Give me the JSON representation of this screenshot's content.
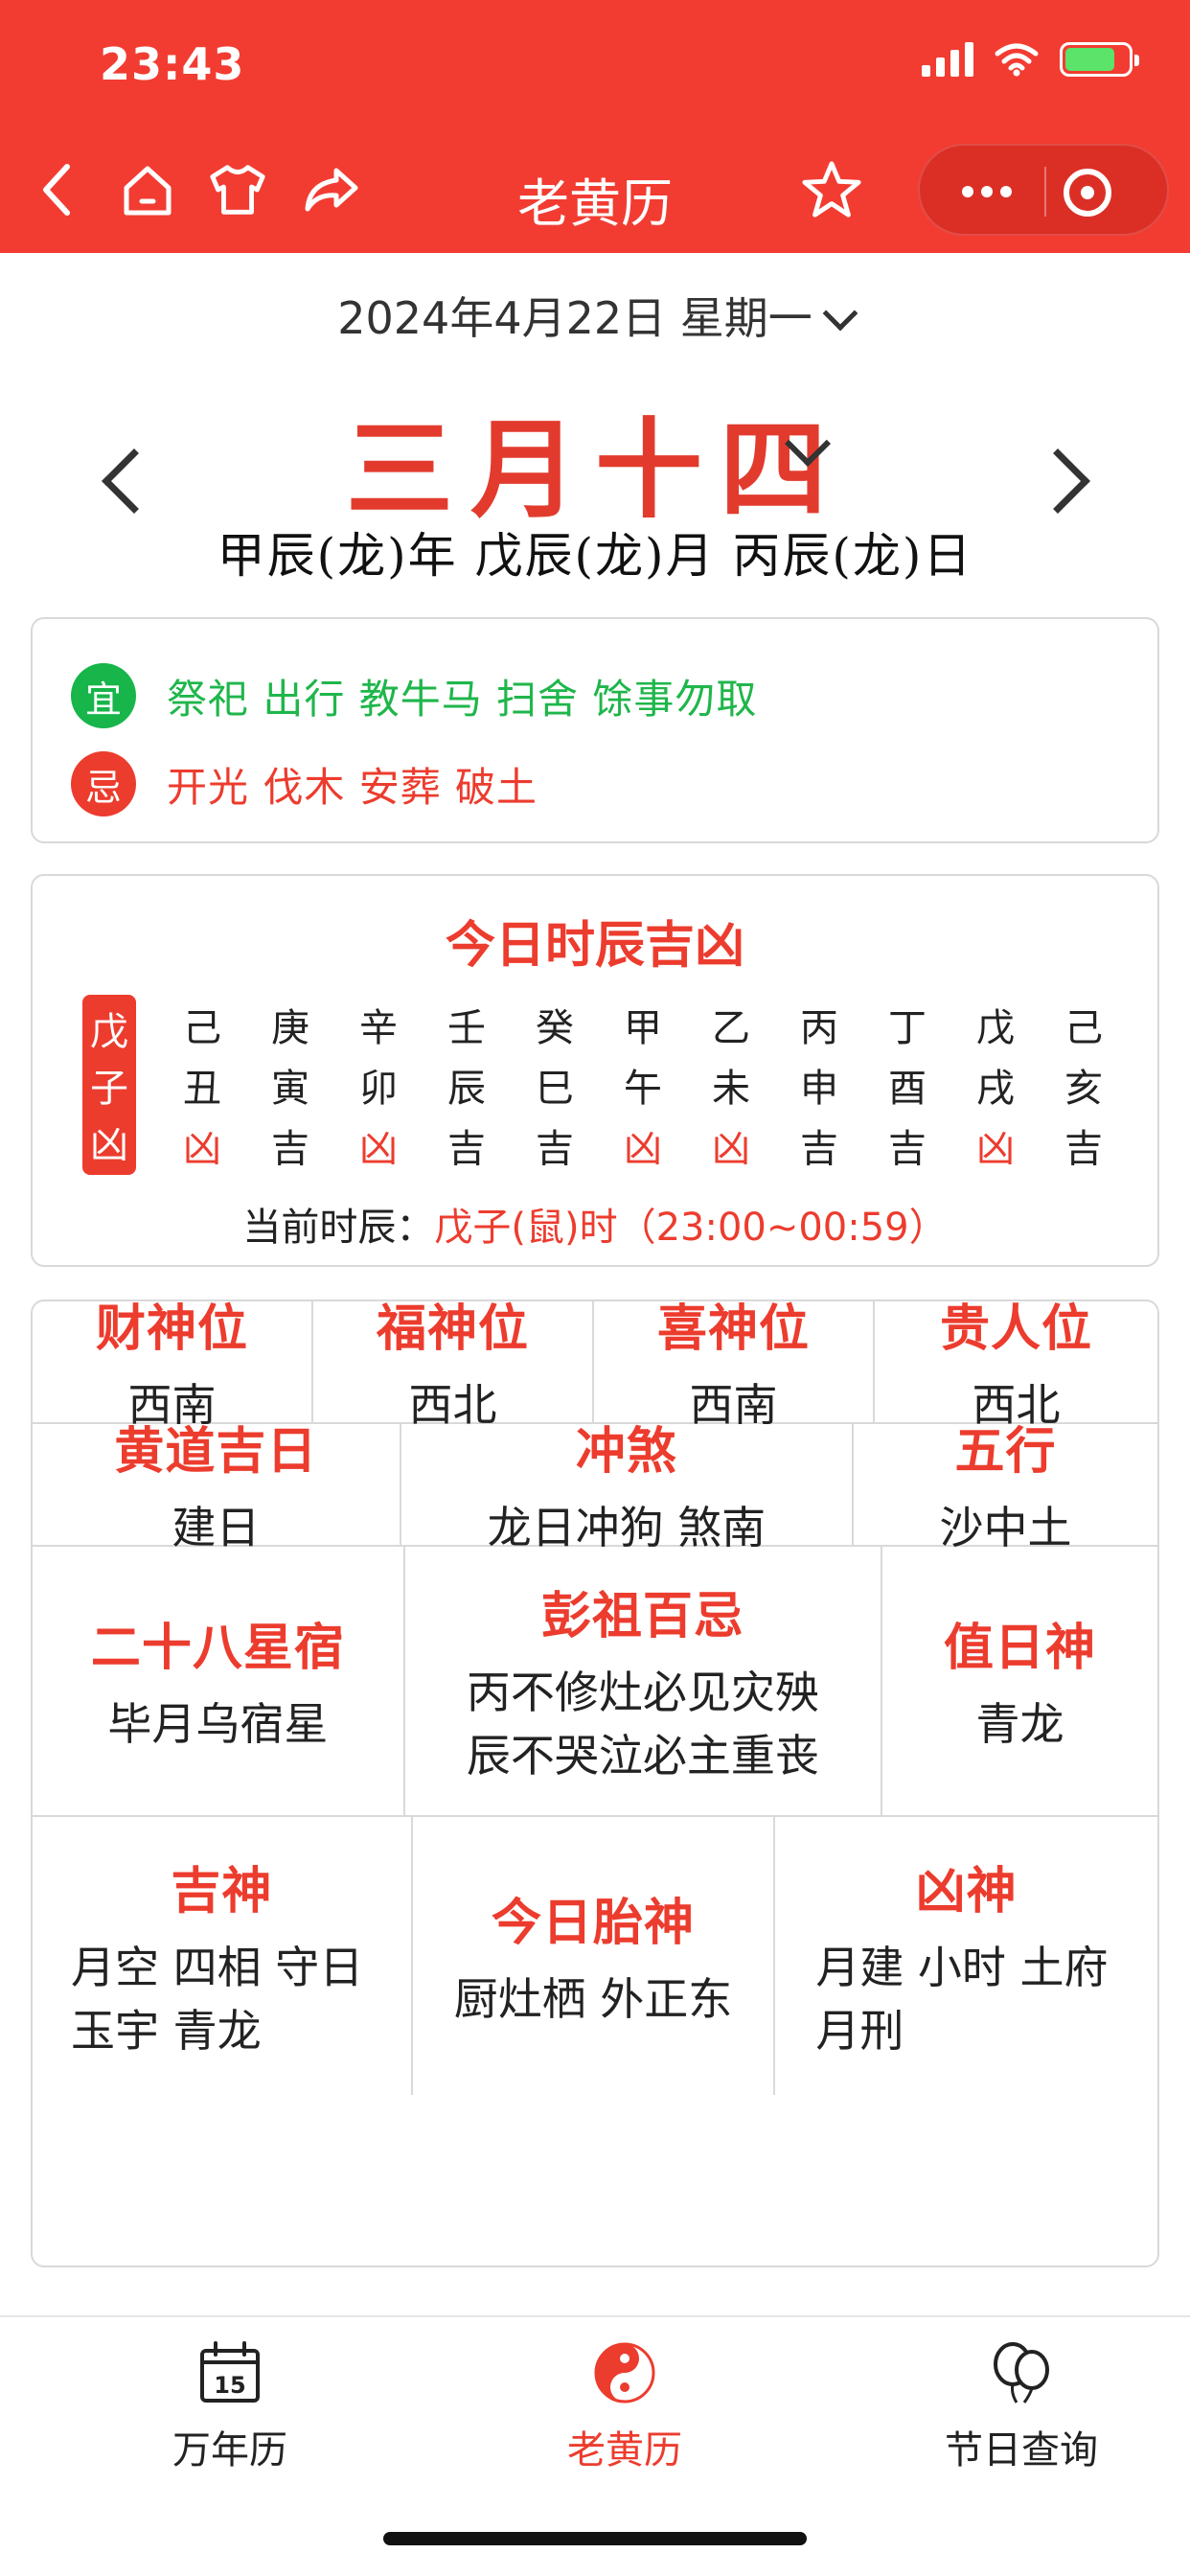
{
  "status_bar": {
    "time": "23:43"
  },
  "nav": {
    "title": "老黄历"
  },
  "date": {
    "solar": "2024年4月22日 星期一",
    "lunar": "三月十四",
    "ganzhi": "甲辰(龙)年 戊辰(龙)月 丙辰(龙)日"
  },
  "yiji": {
    "yi_badge": "宜",
    "yi_text": "祭祀 出行 教牛马 扫舍 馀事勿取",
    "ji_badge": "忌",
    "ji_text": "开光 伐木 安葬 破土"
  },
  "shichen": {
    "title": "今日时辰吉凶",
    "current_col": [
      "戊",
      "子",
      "凶"
    ],
    "cols": [
      [
        "己",
        "丑",
        "凶"
      ],
      [
        "庚",
        "寅",
        "吉"
      ],
      [
        "辛",
        "卯",
        "凶"
      ],
      [
        "壬",
        "辰",
        "吉"
      ],
      [
        "癸",
        "巳",
        "吉"
      ],
      [
        "甲",
        "午",
        "凶"
      ],
      [
        "乙",
        "未",
        "凶"
      ],
      [
        "丙",
        "申",
        "吉"
      ],
      [
        "丁",
        "酉",
        "吉"
      ],
      [
        "戊",
        "戌",
        "凶"
      ],
      [
        "己",
        "亥",
        "吉"
      ]
    ],
    "now_label": "当前时辰：",
    "now_value": "戊子(鼠)时（23:00~00:59）"
  },
  "grid": {
    "row1": [
      {
        "label": "财神位",
        "value": "西南"
      },
      {
        "label": "福神位",
        "value": "西北"
      },
      {
        "label": "喜神位",
        "value": "西南"
      },
      {
        "label": "贵人位",
        "value": "西北"
      }
    ],
    "row2": [
      {
        "label": "黄道吉日",
        "value": "建日"
      },
      {
        "label": "冲煞",
        "value": "龙日冲狗 煞南"
      },
      {
        "label": "五行",
        "value": "沙中土"
      }
    ],
    "row3": [
      {
        "label": "二十八星宿",
        "value": "毕月乌宿星"
      },
      {
        "label": "彭祖百忌",
        "value": "丙不修灶必见灾殃",
        "value2": "辰不哭泣必主重丧"
      },
      {
        "label": "值日神",
        "value": "青龙"
      }
    ],
    "row4": [
      {
        "label": "吉神",
        "value": "月空 四相 守日",
        "value2": "玉宇 青龙"
      },
      {
        "label": "今日胎神",
        "value": "厨灶栖 外正东"
      },
      {
        "label": "凶神",
        "value": "月建 小时 土府",
        "value2": "月刑"
      }
    ]
  },
  "tabbar": {
    "items": [
      {
        "label": "万年历",
        "icon_text": "15"
      },
      {
        "label": "老黄历"
      },
      {
        "label": "节日查询"
      }
    ]
  },
  "colors": {
    "brand_red": "#f23c32",
    "accent_red": "#ec3c2e",
    "green": "#17b54a"
  }
}
